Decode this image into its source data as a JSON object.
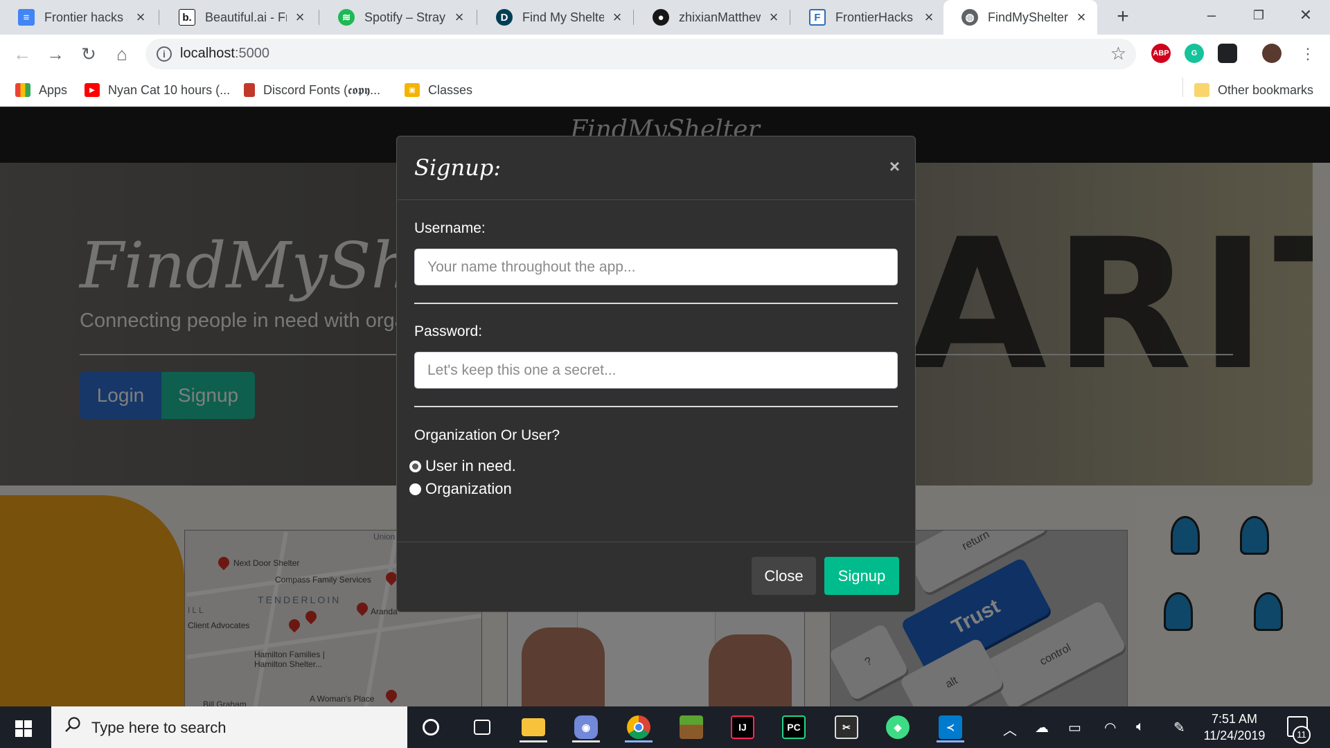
{
  "browser": {
    "tabs": [
      {
        "title": "Frontier hacks sc",
        "icon": "docs-icon",
        "color": "#4285f4"
      },
      {
        "title": "Beautiful.ai - Fro",
        "icon": "beautiful-ai-icon",
        "color": "#111111"
      },
      {
        "title": "Spotify – Stray K",
        "icon": "spotify-icon",
        "color": "#1db954"
      },
      {
        "title": "Find My Shelter",
        "icon": "devpost-icon",
        "color": "#003e54"
      },
      {
        "title": "zhixianMatthew",
        "icon": "github-icon",
        "color": "#181717"
      },
      {
        "title": "FrontierHacks",
        "icon": "frontierhacks-icon",
        "color": "#2f6db5"
      },
      {
        "title": "FindMyShelter -",
        "icon": "globe-icon",
        "color": "#5f6368"
      }
    ],
    "active_tab": 6,
    "url_host": "localhost",
    "url_port": ":5000",
    "bookmarks": [
      {
        "label": "Apps",
        "icon": "apps-grid-icon"
      },
      {
        "label": "Nyan Cat 10 hours (...",
        "icon": "youtube-icon"
      },
      {
        "label": "Discord Fonts (𝖈𝖔𝖕𝖞...",
        "icon": "discord-fonts-icon"
      },
      {
        "label": "Classes",
        "icon": "classes-icon"
      }
    ],
    "other_bookmarks": "Other bookmarks",
    "extensions": [
      "ABP",
      "G",
      "",
      ""
    ]
  },
  "page": {
    "brand": "FindMyShelter",
    "hero_title": "FindMyShel",
    "hero_subtitle": "Connecting people in need with organ",
    "hero_word": "ARITY",
    "login_label": "Login",
    "signup_label": "Signup"
  },
  "cards": {
    "map_labels": [
      "Next Door Shelter",
      "Compass Family Services",
      "TENDERLOIN",
      "Client Advocates",
      "Hamilton Families | Hamilton Shelter...",
      "A Woman's Place",
      "Aranda",
      "Bill Graham",
      "Union",
      "ILL"
    ],
    "keys": {
      "trust": "Trust",
      "return": "return",
      "control": "control",
      "alt": "alt",
      "question": "?"
    }
  },
  "modal": {
    "title": "Signup:",
    "close_symbol": "×",
    "username_label": "Username:",
    "username_placeholder": "Your name throughout the app...",
    "username_value": "",
    "password_label": "Password:",
    "password_placeholder": "Let's keep this one a secret...",
    "password_value": "",
    "role_question": "Organization Or User?",
    "role_options": [
      {
        "label": "User in need.",
        "checked": true
      },
      {
        "label": "Organization",
        "checked": false
      }
    ],
    "close_button": "Close",
    "signup_button": "Signup",
    "colors": {
      "accent": "#00bc8c",
      "modal_bg": "#303030"
    }
  },
  "taskbar": {
    "search_placeholder": "Type here to search",
    "time": "7:51 AM",
    "date": "11/24/2019",
    "notification_count": "11",
    "apps": [
      "cortana-icon",
      "task-view-icon",
      "file-explorer-icon",
      "discord-icon",
      "chrome-icon",
      "minecraft-icon",
      "intellij-icon",
      "pycharm-icon",
      "snipping-icon",
      "android-studio-icon",
      "vscode-icon"
    ]
  }
}
